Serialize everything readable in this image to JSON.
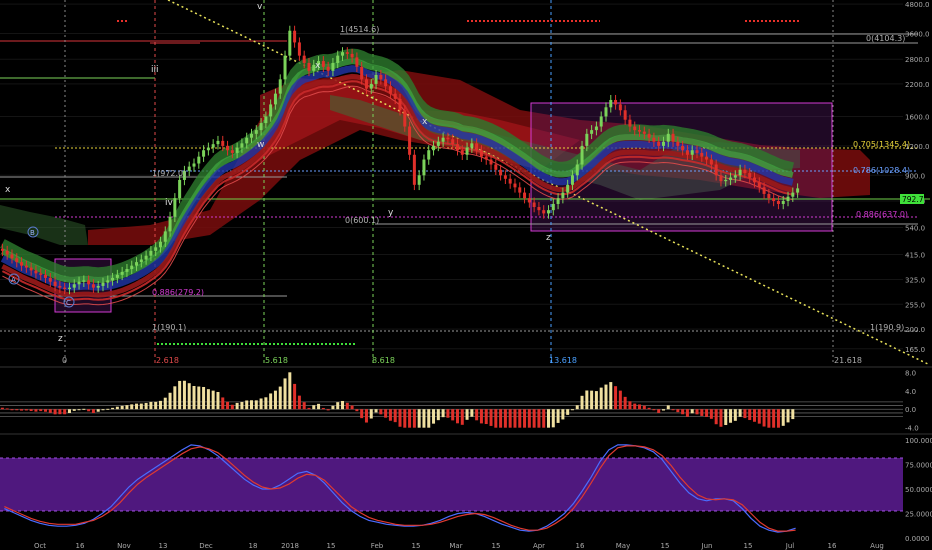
{
  "chart_data": [
    {
      "type": "candlestick",
      "pane": "price",
      "scale": "log",
      "ylim": [
        145,
        4900
      ],
      "y_ticks": [
        "4800.0",
        "3600.0",
        "2800.0",
        "2200.0",
        "1600.0",
        "1200.0",
        "900.0",
        "700.0",
        "540.0",
        "415.0",
        "325.0",
        "255.0",
        "200.0",
        "165.0"
      ],
      "last_price_label": "792.7",
      "series": [
        {
          "name": "close",
          "values": [
            430,
            415,
            400,
            385,
            372,
            365,
            355,
            345,
            340,
            330,
            318,
            305,
            300,
            296,
            300,
            310,
            318,
            322,
            310,
            300,
            305,
            315,
            322,
            330,
            340,
            350,
            360,
            372,
            385,
            395,
            410,
            430,
            445,
            470,
            520,
            600,
            720,
            860,
            940,
            980,
            1010,
            1080,
            1150,
            1180,
            1220,
            1260,
            1200,
            1150,
            1120,
            1180,
            1230,
            1300,
            1350,
            1400,
            1500,
            1600,
            1800,
            2000,
            2300,
            2900,
            3700,
            3300,
            2900,
            2700,
            2500,
            2650,
            2750,
            2600,
            2500,
            2700,
            2900,
            3000,
            2950,
            2850,
            2600,
            2300,
            2100,
            2200,
            2400,
            2300,
            2150,
            2000,
            1900,
            1700,
            1450,
            1100,
            820,
            900,
            1050,
            1150,
            1200,
            1250,
            1300,
            1280,
            1220,
            1150,
            1100,
            1180,
            1230,
            1150,
            1080,
            1050,
            1000,
            950,
            900,
            870,
            830,
            800,
            760,
            720,
            690,
            660,
            640,
            620,
            640,
            680,
            720,
            760,
            820,
            900,
            1000,
            1200,
            1350,
            1400,
            1450,
            1600,
            1750,
            1880,
            1800,
            1700,
            1550,
            1450,
            1400,
            1380,
            1350,
            1300,
            1250,
            1200,
            1250,
            1350,
            1250,
            1200,
            1150,
            1100,
            1150,
            1120,
            1080,
            1050,
            1000,
            900,
            850,
            860,
            880,
            900,
            950,
            920,
            880,
            840,
            800,
            750,
            720,
            700,
            680,
            700,
            730,
            760,
            792
          ]
        },
        {
          "name": "ema",
          "values": [
            420,
            410,
            400,
            390,
            380,
            372,
            365,
            358,
            350,
            343,
            336,
            330,
            324,
            320,
            318,
            318,
            319,
            320,
            320,
            318,
            317,
            318,
            320,
            323,
            327,
            332,
            338,
            345,
            353,
            362,
            372,
            384,
            397,
            413,
            435,
            465,
            505,
            555,
            605,
            655,
            705,
            760,
            815,
            865,
            915,
            965,
            1000,
            1025,
            1045,
            1070,
            1100,
            1135,
            1175,
            1220,
            1270,
            1330,
            1410,
            1500,
            1620,
            1800,
            2050,
            2230,
            2350,
            2420,
            2450,
            2490,
            2530,
            2550,
            2545,
            2560,
            2600,
            2640,
            2670,
            2690,
            2680,
            2640,
            2580,
            2540,
            2520,
            2490,
            2450,
            2390,
            2320,
            2230,
            2110,
            1950,
            1780,
            1660,
            1580,
            1530,
            1500,
            1480,
            1470,
            1460,
            1450,
            1430,
            1400,
            1390,
            1380,
            1365,
            1345,
            1320,
            1295,
            1265,
            1235,
            1200,
            1165,
            1130,
            1095,
            1060,
            1025,
            990,
            960,
            935,
            915,
            900,
            890,
            890,
            895,
            910,
            940,
            975,
            1010,
            1050,
            1095,
            1145,
            1195,
            1235,
            1260,
            1275,
            1280,
            1282,
            1283,
            1282,
            1278,
            1272,
            1268,
            1270,
            1275,
            1272,
            1265,
            1255,
            1243,
            1235,
            1225,
            1212,
            1198,
            1182,
            1160,
            1135,
            1115,
            1098,
            1085,
            1077,
            1068,
            1055,
            1040,
            1020,
            1000,
            980,
            960,
            940,
            920,
            905,
            895,
            885
          ]
        }
      ]
    },
    {
      "type": "bar",
      "pane": "momentum",
      "ylim": [
        -4.5,
        8.5
      ],
      "y_ticks": [
        "8.0",
        "4.0",
        "0.0",
        "-4.0"
      ]
    },
    {
      "type": "line",
      "pane": "oscillator",
      "ylim": [
        0,
        100
      ],
      "y_ticks": [
        "100.0000",
        "75.0000",
        "50.0000",
        "25.0000",
        "0.0000"
      ],
      "series": [
        {
          "color": "#4a6cff",
          "values": [
            30,
            26,
            22,
            18,
            15,
            13,
            12,
            12,
            13,
            15,
            19,
            25,
            32,
            42,
            52,
            60,
            66,
            72,
            78,
            84,
            90,
            95,
            94,
            90,
            84,
            76,
            68,
            60,
            54,
            50,
            50,
            54,
            60,
            66,
            68,
            64,
            56,
            46,
            36,
            28,
            22,
            18,
            16,
            14,
            13,
            12,
            12,
            13,
            15,
            18,
            22,
            25,
            26,
            25,
            22,
            18,
            14,
            11,
            8,
            7,
            8,
            12,
            18,
            25,
            35,
            48,
            62,
            78,
            90,
            95,
            95,
            94,
            92,
            88,
            80,
            68,
            56,
            46,
            40,
            38,
            40,
            40,
            38,
            30,
            20,
            12,
            8,
            6,
            7,
            10
          ]
        },
        {
          "color": "#e03a30",
          "values": [
            32,
            28,
            24,
            20,
            17,
            15,
            14,
            14,
            14,
            16,
            18,
            22,
            28,
            36,
            46,
            55,
            62,
            68,
            74,
            80,
            86,
            91,
            93,
            91,
            87,
            80,
            72,
            64,
            57,
            52,
            50,
            51,
            55,
            61,
            65,
            64,
            59,
            50,
            41,
            32,
            26,
            21,
            18,
            16,
            14,
            13,
            13,
            13,
            14,
            16,
            19,
            22,
            24,
            25,
            24,
            21,
            17,
            13,
            10,
            8,
            8,
            10,
            15,
            21,
            30,
            42,
            56,
            71,
            84,
            92,
            94,
            94,
            93,
            90,
            84,
            74,
            62,
            52,
            44,
            40,
            39,
            40,
            39,
            34,
            25,
            16,
            10,
            7,
            7,
            8
          ]
        }
      ]
    }
  ],
  "annotations": {
    "level_labels": [
      "1(4514.6)",
      "0(4104.3)",
      "0.705(1345.4)",
      "0.786(1028.4)",
      "1(972.0)",
      "0.886(637.0)",
      "0(600.1)",
      "0.886(279.2)",
      "1(190.1)",
      "1(190.9)"
    ],
    "wave_labels": [
      "v",
      "x",
      "x",
      "iii",
      "iv",
      "w",
      "y",
      "z",
      "z",
      "A",
      "B",
      "C"
    ],
    "fib_time_labels": [
      "0",
      "2.618",
      "5.618",
      "8.618",
      "13.618",
      "21.618"
    ],
    "x_axis_labels": [
      "Oct",
      "16",
      "Nov",
      "13",
      "Dec",
      "18",
      "2018",
      "15",
      "Feb",
      "15",
      "Mar",
      "15",
      "Apr",
      "16",
      "May",
      "15",
      "Jun",
      "15",
      "Jul",
      "16",
      "Aug"
    ]
  }
}
